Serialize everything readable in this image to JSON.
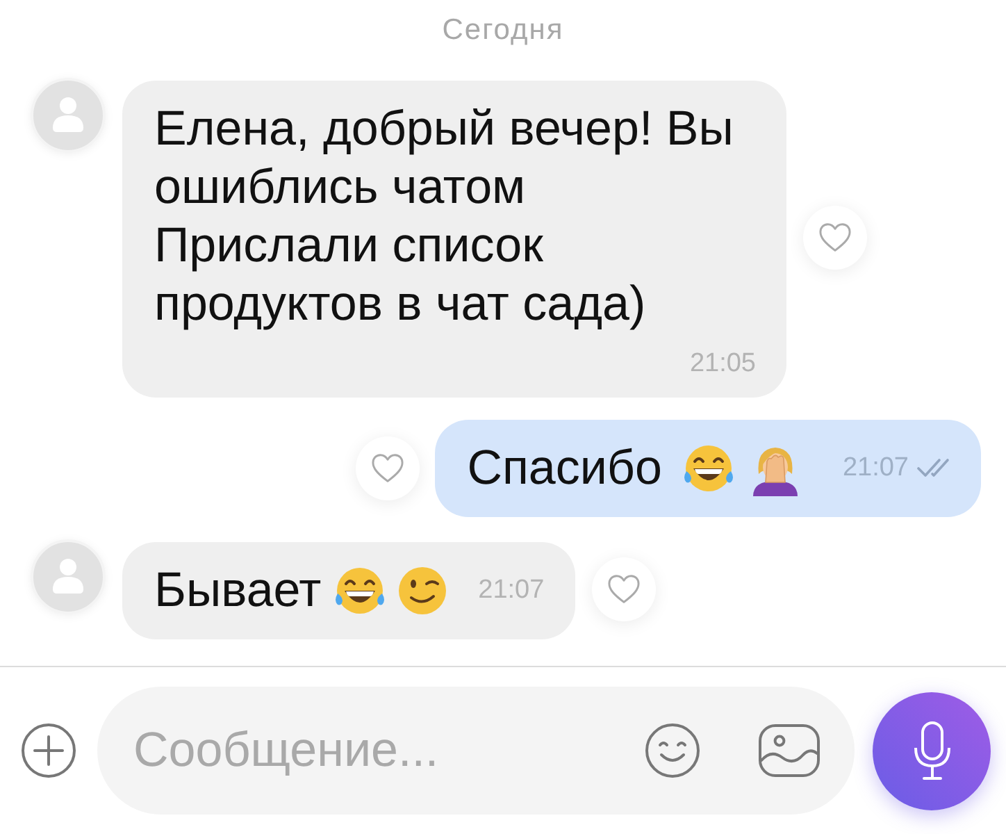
{
  "date_label": "Сегодня",
  "messages": [
    {
      "kind": "incoming",
      "text": "Елена, добрый вечер! Вы ошиблись чатом\nПрислали список продуктов в чат сада)",
      "time": "21:05",
      "liked": false
    },
    {
      "kind": "outgoing",
      "text": "Спасибо",
      "emojis": [
        {
          "kind": "laughing"
        },
        {
          "kind": "facepalm"
        }
      ],
      "time": "21:07",
      "read": true,
      "liked": false
    },
    {
      "kind": "incoming",
      "text": "Бывает",
      "emojis": [
        {
          "kind": "laughing"
        },
        {
          "kind": "wink"
        }
      ],
      "time": "21:07",
      "liked": false
    }
  ],
  "composer": {
    "placeholder": "Сообщение..."
  }
}
